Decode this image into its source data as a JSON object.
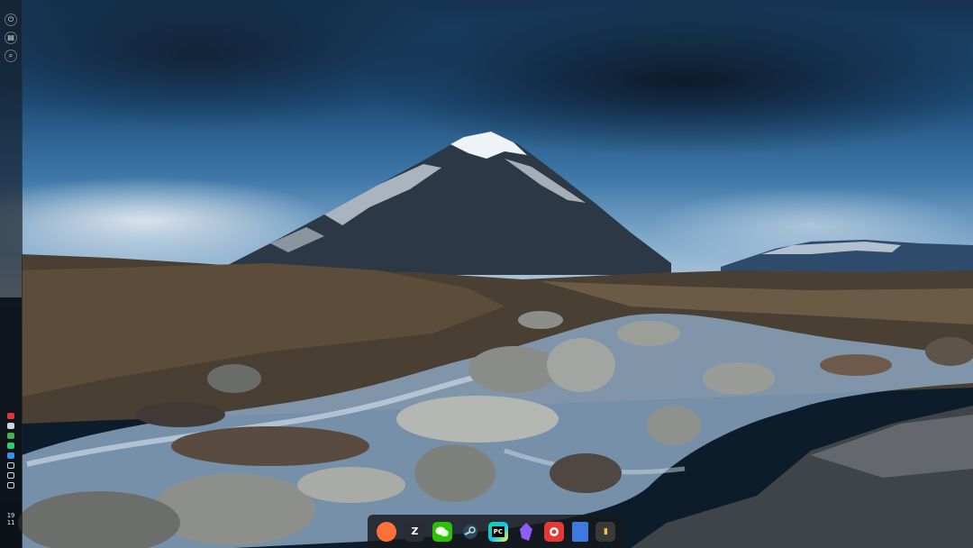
{
  "left_bar": {
    "top_buttons": [
      {
        "icon": "power-icon",
        "glyph": "⏻"
      },
      {
        "icon": "clipboard-icon",
        "glyph": "▤"
      },
      {
        "icon": "search-icon",
        "glyph": "⌕"
      }
    ],
    "tray_icons": [
      {
        "icon": "record-icon",
        "color": "#e0343a"
      },
      {
        "icon": "note-icon",
        "color": "#cfd6de"
      },
      {
        "icon": "android-icon",
        "color": "#4caf50"
      },
      {
        "icon": "chat-icon",
        "color": "#2ecc71"
      },
      {
        "icon": "bluetooth-icon",
        "color": "#3b8fe8"
      },
      {
        "icon": "refresh-icon",
        "color": "#cfd6de"
      },
      {
        "icon": "shield-icon",
        "color": "#cfd6de"
      },
      {
        "icon": "notification-icon",
        "color": "#cfd6de"
      }
    ],
    "clock": {
      "hour": "19",
      "minute": "11"
    }
  },
  "dock": {
    "items": [
      {
        "name": "firefox",
        "icon": "firefox-icon",
        "glyph": "",
        "color": "#ff7139"
      },
      {
        "name": "zed",
        "icon": "zed-icon",
        "glyph": "Z",
        "color": "#2a2c33"
      },
      {
        "name": "wechat",
        "icon": "wechat-icon",
        "glyph": "",
        "color": "#2dc100"
      },
      {
        "name": "steam",
        "icon": "steam-icon",
        "glyph": "",
        "color": "#1b2838"
      },
      {
        "name": "pycharm",
        "icon": "pycharm-icon",
        "glyph": "PC",
        "color": "#1f1f1f"
      },
      {
        "name": "obsidian",
        "icon": "obsidian-icon",
        "glyph": "",
        "color": "#7c4dff"
      },
      {
        "name": "app-red",
        "icon": "red-app-icon",
        "glyph": "",
        "color": "#e53935"
      },
      {
        "name": "documents",
        "icon": "document-icon",
        "glyph": "",
        "color": "#3d7ae0"
      },
      {
        "name": "terminal",
        "icon": "terminal-icon",
        "glyph": "",
        "color": "#3a3a3a"
      }
    ]
  }
}
